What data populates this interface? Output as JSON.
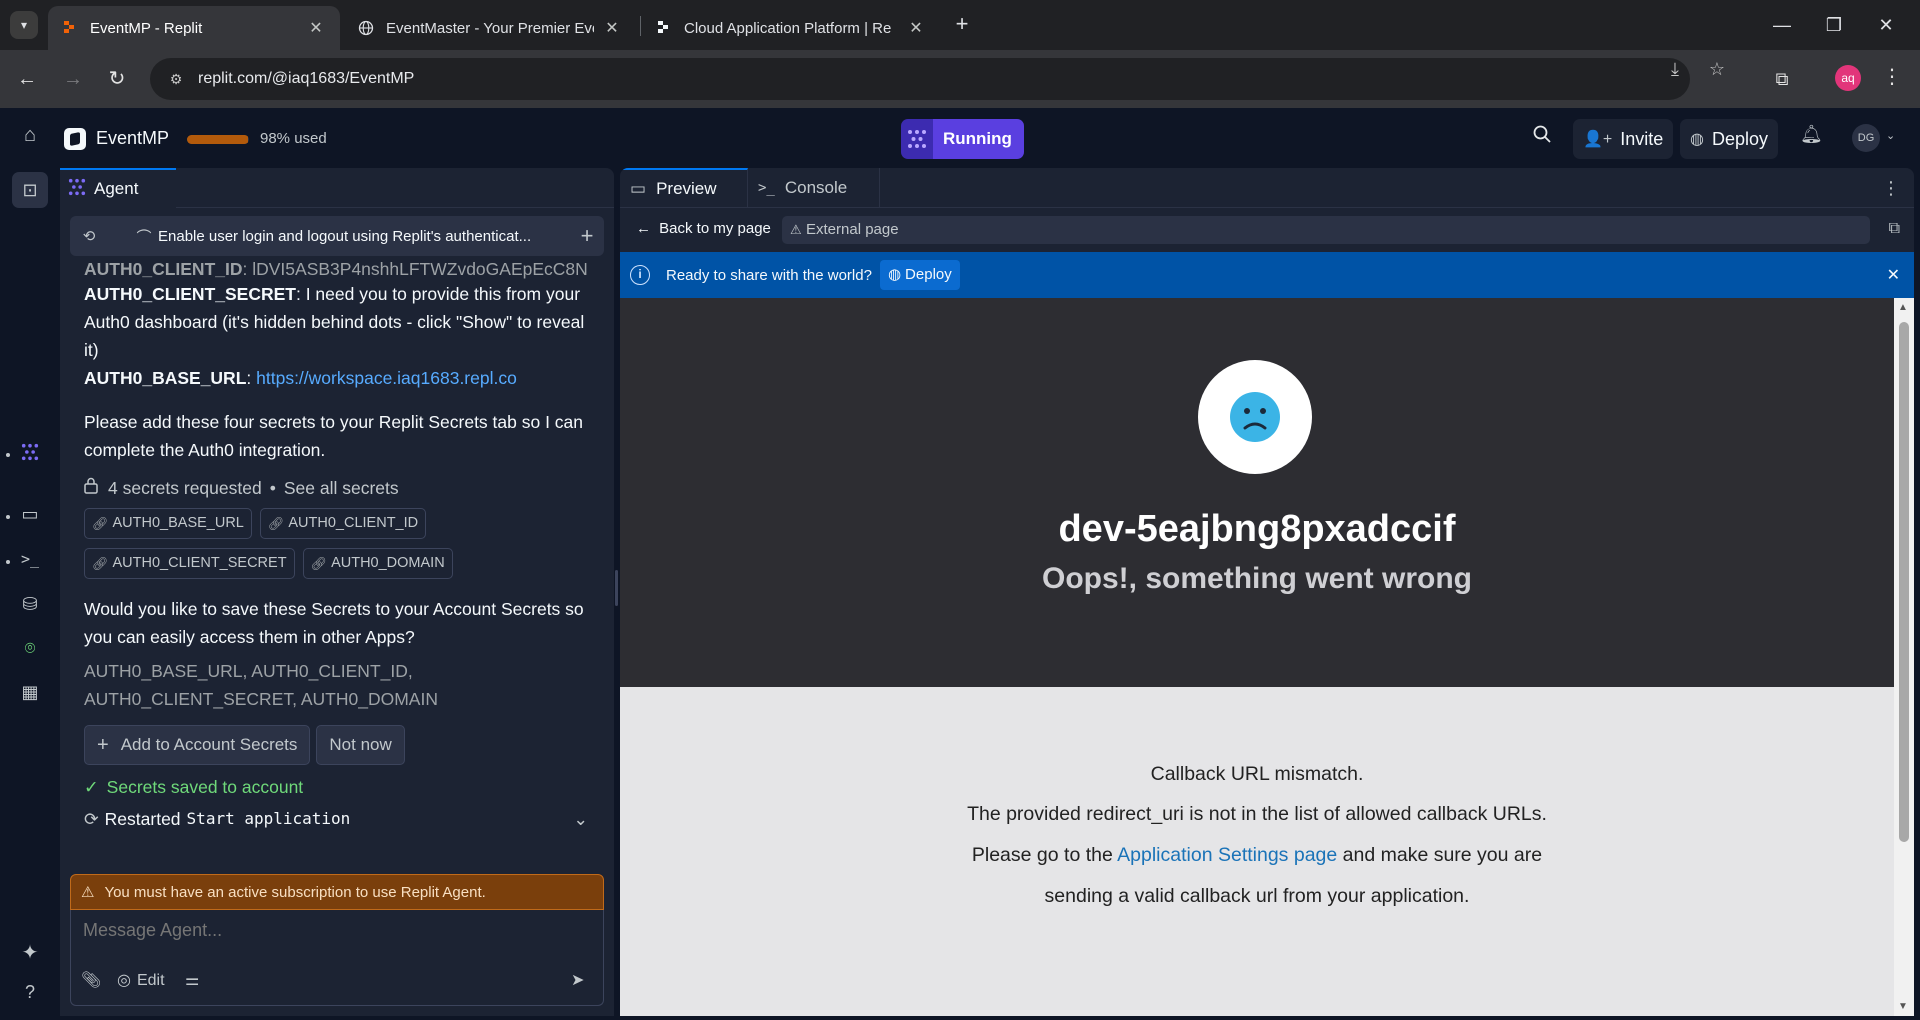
{
  "browser": {
    "tabs": [
      {
        "title": "EventMP - Replit",
        "active": true
      },
      {
        "title": "EventMaster - Your Premier Eve",
        "active": false
      },
      {
        "title": "Cloud Application Platform | Re",
        "active": false
      }
    ],
    "url": "replit.com/@iaq1683/EventMP",
    "profile_initials": "aq"
  },
  "header": {
    "repl_name": "EventMP",
    "usage_percent": 98,
    "usage_text": "98% used",
    "run_label": "Running",
    "invite_label": "Invite",
    "deploy_label": "Deploy",
    "user_initials": "DG"
  },
  "agent": {
    "tab_label": "Agent",
    "thread_title": "Enable user login and logout using Replit's authenticat...",
    "cut_line_key": "AUTH0_CLIENT_ID",
    "cut_line_val": ": lDVI5ASB3P4nshhLFTWZvdoGAEpEcC8N",
    "secret_key": "AUTH0_CLIENT_SECRET",
    "secret_text": ": I need you to provide this from your Auth0 dashboard (it's hidden behind dots - click \"Show\" to reveal it)",
    "base_url_key": "AUTH0_BASE_URL",
    "base_url_val": "https://workspace.iaq1683.repl.co",
    "add_secrets_text": "Please add these four secrets to your Replit Secrets tab so I can complete the Auth0 integration.",
    "secrets_requested": "4 secrets requested",
    "see_all": "See all secrets",
    "chips": [
      "AUTH0_BASE_URL",
      "AUTH0_CLIENT_ID",
      "AUTH0_CLIENT_SECRET",
      "AUTH0_DOMAIN"
    ],
    "save_question": "Would you like to save these Secrets to your Account Secrets so you can easily access them in other Apps?",
    "secret_list": "AUTH0_BASE_URL, AUTH0_CLIENT_ID, AUTH0_CLIENT_SECRET, AUTH0_DOMAIN",
    "add_account_btn": "Add to Account Secrets",
    "not_now_btn": "Not now",
    "saved_msg": "Secrets saved to account",
    "restarted_prefix": "Restarted",
    "restarted_cmd": "Start application",
    "subscription_warning": "You must have an active subscription to use Replit Agent.",
    "message_placeholder": "Message Agent...",
    "edit_label": "Edit"
  },
  "preview": {
    "tab_preview": "Preview",
    "tab_console": "Console",
    "back_label": "Back to my page",
    "external_label": "External page",
    "banner_text": "Ready to share with the world?",
    "banner_deploy": "Deploy",
    "error_title": "dev-5eajbng8pxadccif",
    "error_subtitle": "Oops!, something went wrong",
    "line1": "Callback URL mismatch.",
    "line2": "The provided redirect_uri is not in the list of allowed callback URLs.",
    "line3_pre": "Please go to the",
    "line3_link": "Application Settings page",
    "line3_post": "and make sure you are",
    "line4": "sending a valid callback url from your application."
  }
}
